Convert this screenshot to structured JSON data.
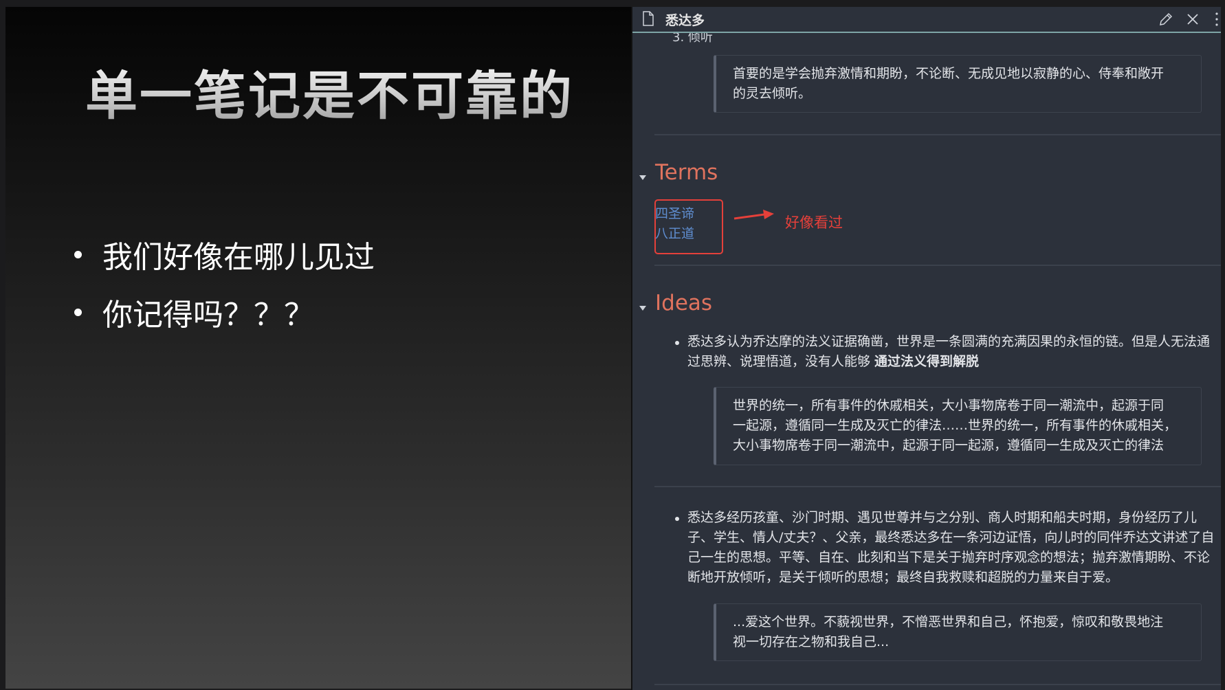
{
  "slide": {
    "title": "单一笔记是不可靠的",
    "bullets": [
      "我们好像在哪儿见过",
      "你记得吗？？？"
    ]
  },
  "note": {
    "title": "悉达多",
    "partial_item": "3. 倾听",
    "top_quote": [
      "首要的是学会抛弃激情和期盼，不论断、无成见地以寂静的心、侍奉和敞开",
      "的灵去倾听。"
    ],
    "terms": {
      "heading": "Terms",
      "links": [
        "四圣谛",
        "八正道"
      ],
      "annotation": "好像看过"
    },
    "ideas": {
      "heading": "Ideas",
      "items": [
        {
          "lines": [
            "悉达多认为乔达摩的法义证据确凿，世界是一条圆满的充满因果的永恒的链。但是人无法通",
            "过思辨、说理悟道，没有人能够 "
          ],
          "bold": "通过法义得到解脱",
          "quote": [
            "世界的统一，所有事件的休戚相关，大小事物席卷于同一潮流中，起源于同",
            "一起源，遵循同一生成及灭亡的律法……世界的统一，所有事件的休戚相关，",
            "大小事物席卷于同一潮流中，起源于同一起源，遵循同一生成及灭亡的律法"
          ]
        },
        {
          "lines": [
            "悉达多经历孩童、沙门时期、遇见世尊并与之分别、商人时期和船夫时期，身份经历了儿",
            "子、学生、情人/丈夫？、父亲，最终悉达多在一条河边证悟，向儿时的同伴乔达文讲述了自",
            "己一生的思想。平等、自在、此刻和当下是关于抛弃时序观念的想法；抛弃激情期盼、不论",
            "断地开放倾听，是关于倾听的思想；最终自我救赎和超脱的力量来自于爱。"
          ],
          "quote": [
            "...爱这个世界。不藐视世界，不憎恶世界和自己，怀抱爱，惊叹和敬畏地注",
            "视一切存在之物和我自己..."
          ]
        }
      ]
    }
  },
  "colors": {
    "heading_accent": "#e0735e",
    "link": "#5f8ed1",
    "annotation_red": "#e5403a",
    "panel_bg": "#2c313b"
  }
}
